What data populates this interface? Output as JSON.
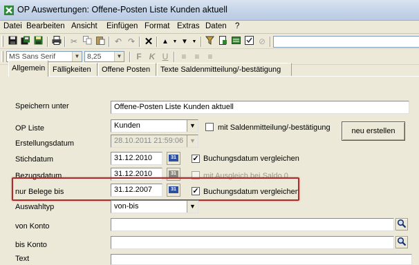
{
  "window": {
    "title": "OP Auswertungen: Offene-Posten Liste Kunden aktuell"
  },
  "menu": [
    "Datei",
    "Bearbeiten",
    "Ansicht",
    "Einfügen",
    "Format",
    "Extras",
    "Daten",
    "?"
  ],
  "format_toolbar": {
    "font": "MS Sans Serif",
    "size": "8,25",
    "bold": "F",
    "italic": "K",
    "underline": "U"
  },
  "tabs": [
    "Allgemein",
    "Fälligkeiten",
    "Offene Posten",
    "Texte Saldenmitteilung/-bestätigung"
  ],
  "form": {
    "speichern_label": "Speichern unter",
    "speichern_value": "Offene-Posten Liste Kunden aktuell",
    "op_liste_label": "OP Liste",
    "op_liste_value": "Kunden",
    "saldenmitteilung_label": "mit Saldenmitteilung/-bestätigung",
    "neu_erstellen_label": "neu erstellen",
    "erstellungsdatum_label": "Erstellungsdatum",
    "erstellungsdatum_value": "28.10.2011 21:59:06",
    "stichdatum_label": "Stichdatum",
    "stichdatum_value": "31.12.2010",
    "buchungsdatum_vergleichen_1": "Buchungsdatum vergleichen",
    "bezugsdatum_label": "Bezugsdatum",
    "bezugsdatum_value": "31.12.2010",
    "ausgleich_label": "mit Ausgleich bei Saldo 0",
    "nur_belege_label": "nur Belege bis",
    "nur_belege_value": "31.12.2007",
    "buchungsdatum_vergleichen_2": "Buchungsdatum vergleichen",
    "auswahltyp_label": "Auswahltyp",
    "auswahltyp_value": "von-bis",
    "von_konto_label": "von Konto",
    "von_konto_value": "",
    "bis_konto_label": "bis Konto",
    "bis_konto_value": "",
    "text_label": "Text",
    "calendar_glyph": "31"
  },
  "colors": {
    "highlight": "#b02a2a",
    "titlebar": "#c3d3e8",
    "face": "#ece9d8"
  }
}
